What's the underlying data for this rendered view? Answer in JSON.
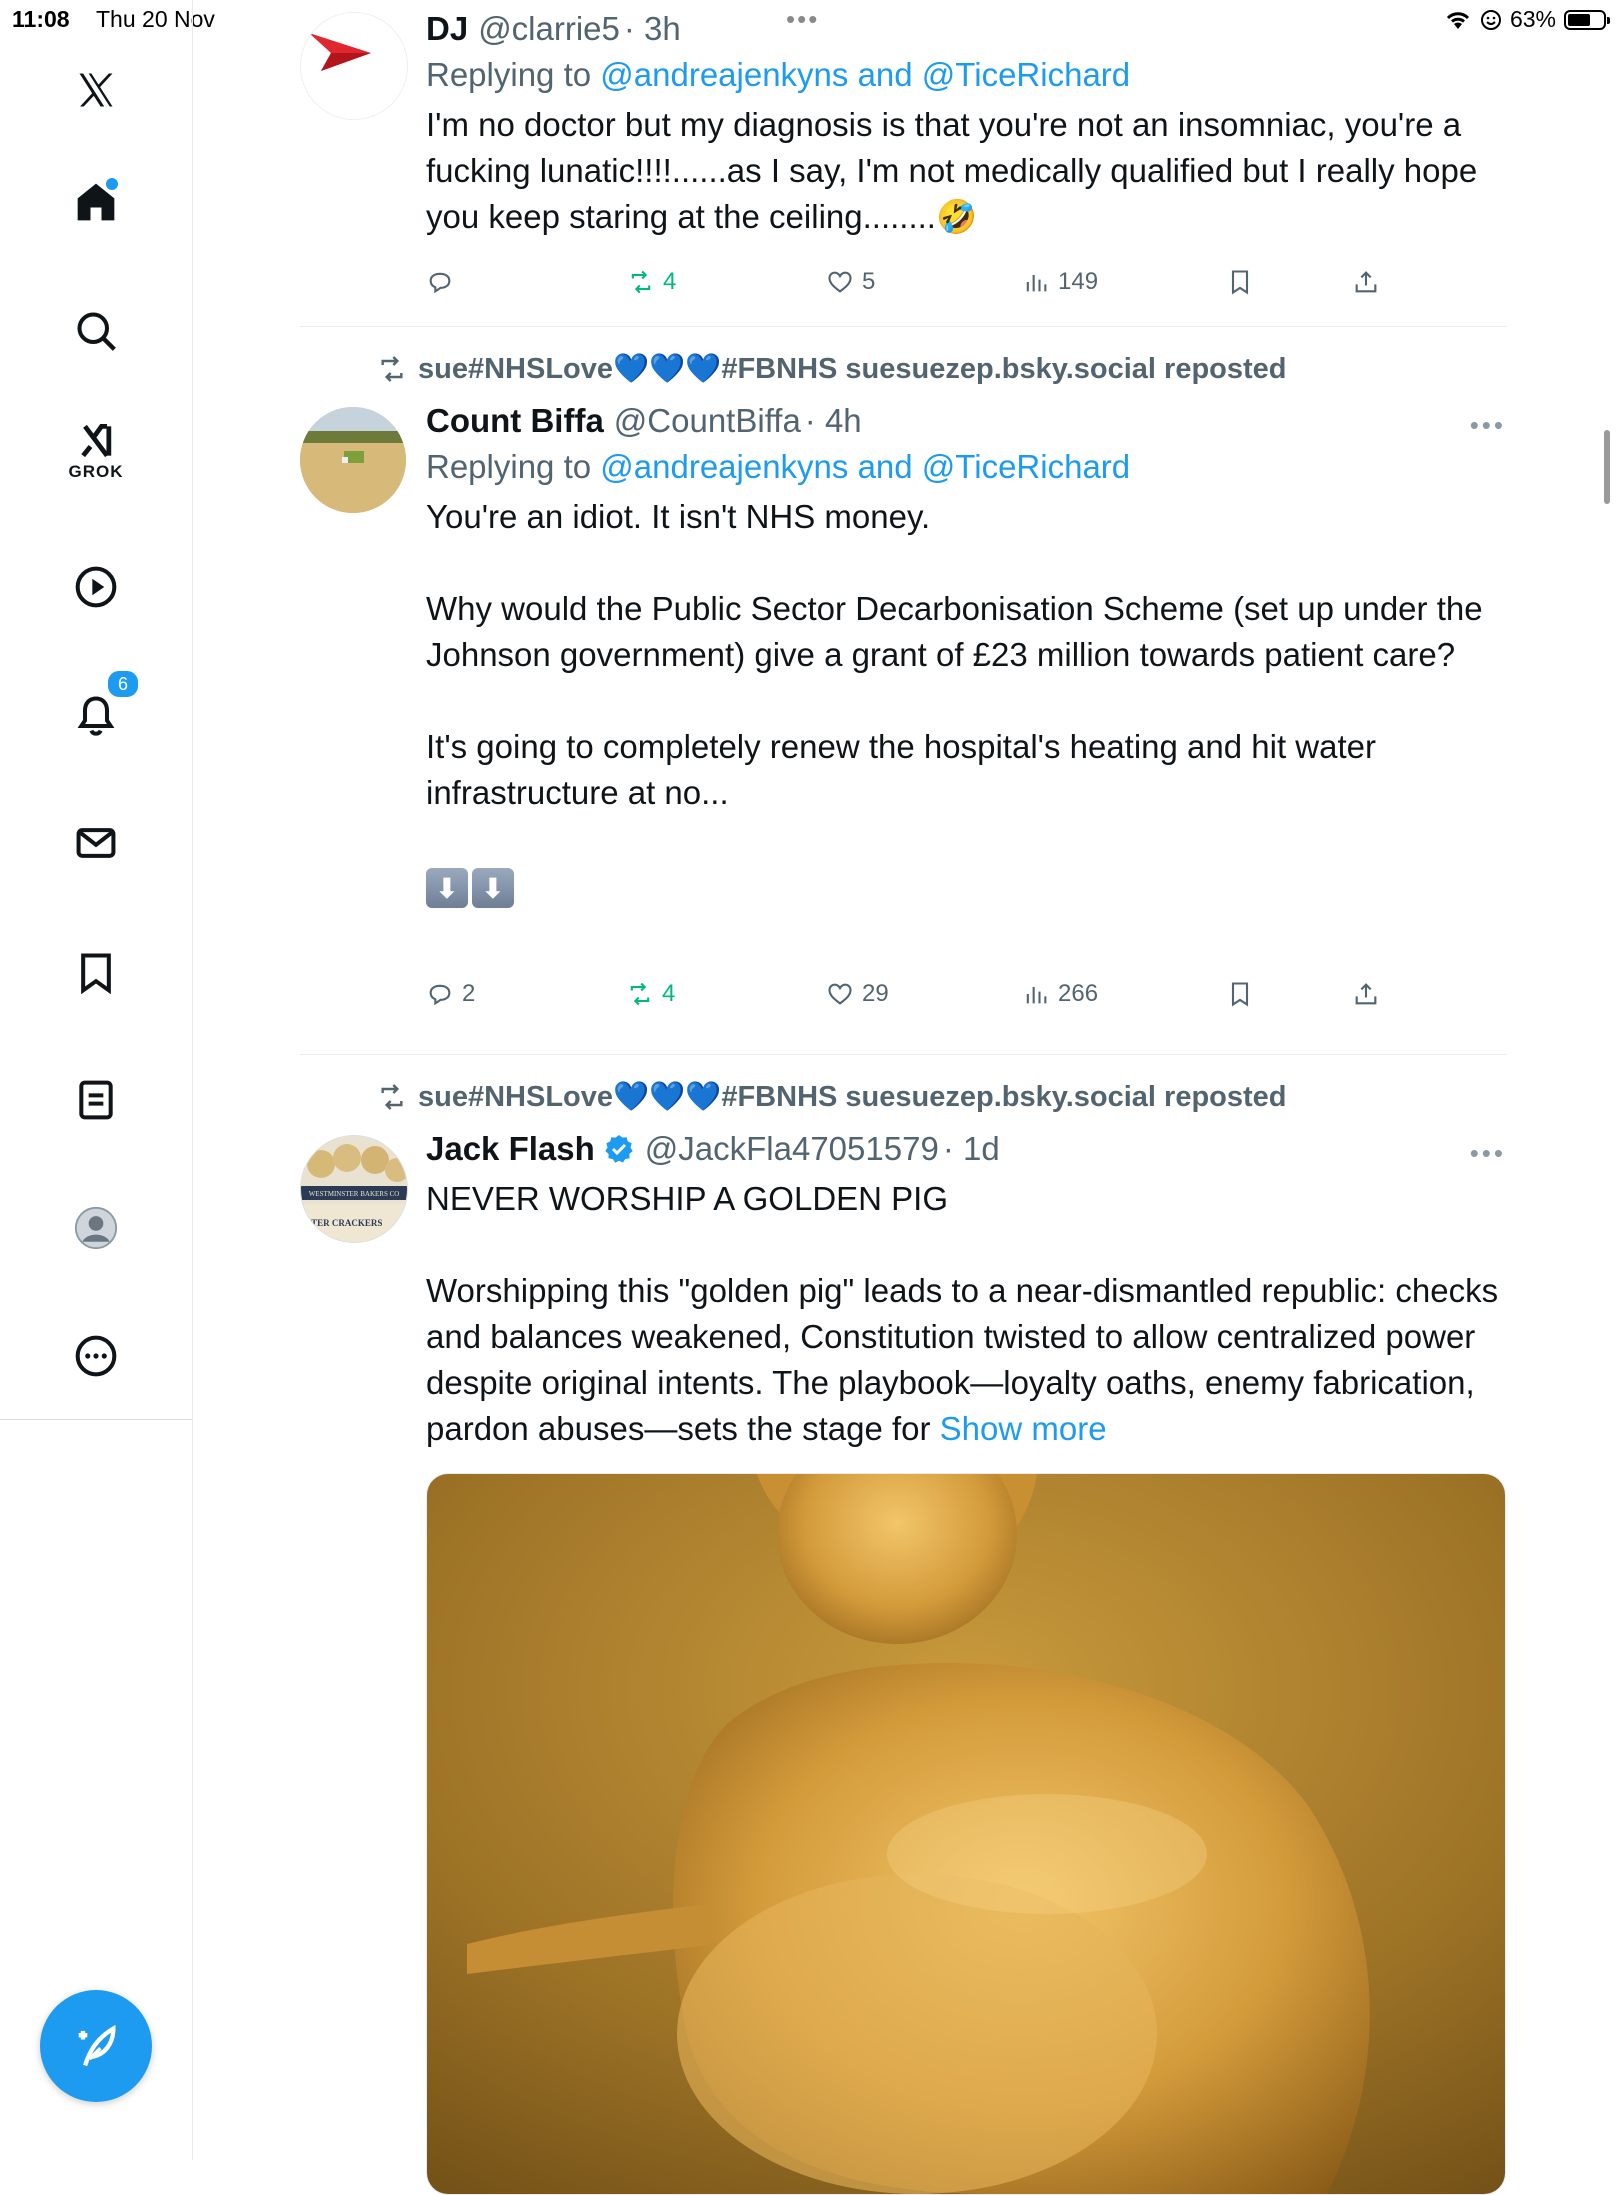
{
  "status_bar": {
    "time": "11:08",
    "date": "Thu 20 Nov",
    "dots": "•••",
    "battery": "63%",
    "battery_level": 0.63
  },
  "sidebar": {
    "grok_label": "GROK",
    "notifications_count": "6",
    "items": [
      "x-logo",
      "home",
      "search",
      "grok",
      "video",
      "notifications",
      "messages",
      "bookmarks",
      "lists",
      "profile",
      "more"
    ]
  },
  "tweets": [
    {
      "name": "DJ",
      "handle": "@clarrie5",
      "time": "· 3h",
      "reply_prefix": "Replying to ",
      "reply_to": "@andreajenkyns and @TiceRichard",
      "text": "I'm no doctor but my diagnosis is that you're not an insomniac, you're a fucking lunatic!!!!......as I say, I'm not medically qualified but I really hope you keep staring at the ceiling........🤣",
      "replies": "",
      "reposts": "4",
      "likes": "5",
      "views": "149"
    },
    {
      "reposted_by": "sue#NHSLove💙💙💙#FBNHS suesuezep.bsky.social reposted",
      "name": "Count Biffa",
      "handle": "@CountBiffa",
      "time": "· 4h",
      "reply_prefix": "Replying to ",
      "reply_to": "@andreajenkyns and @TiceRichard",
      "text": "You're an idiot. It isn't NHS money.\n\nWhy would the Public Sector Decarbonisation Scheme (set up under the Johnson government) give a grant of £23 million towards patient care?\n\nIt's going to completely renew the hospital's heating and hit water infrastructure at no...",
      "emoji_row": [
        "⬇",
        "⬇"
      ],
      "replies": "2",
      "reposts": "4",
      "likes": "29",
      "views": "266"
    },
    {
      "reposted_by": "sue#NHSLove💙💙💙#FBNHS suesuezep.bsky.social reposted",
      "name": "Jack Flash",
      "handle": "@JackFla47051579",
      "time": "· 1d",
      "text": "NEVER WORSHIP A GOLDEN PIG\n\nWorshipping this \"golden pig\" leads to a near-dismantled republic: checks and balances weakened, Constitution twisted to allow centralized power despite original intents. The playbook—loyalty oaths, enemy fabrication, pardon abuses—sets the stage for ",
      "show_more": "Show more",
      "avatar_text": [
        "WESTMINSTER BAKERS CO",
        "NSTER CRACKERS"
      ]
    }
  ],
  "colors": {
    "accent": "#1d9bf0",
    "repost_green": "#00ba7c",
    "muted": "#536471"
  }
}
